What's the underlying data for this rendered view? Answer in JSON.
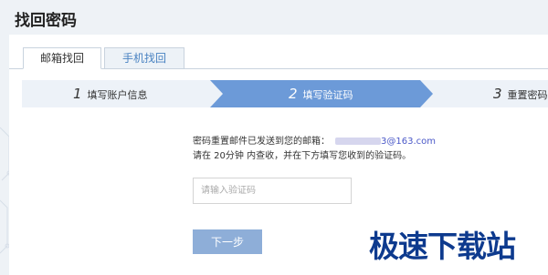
{
  "page": {
    "title": "找回密码"
  },
  "tabs": [
    {
      "label": "邮箱找回",
      "active": true
    },
    {
      "label": "手机找回",
      "active": false
    }
  ],
  "steps": [
    {
      "number": "1",
      "label": "填写账户信息",
      "state": "done"
    },
    {
      "number": "2",
      "label": "填写验证码",
      "state": "current"
    },
    {
      "number": "3",
      "label": "重置密码",
      "state": "pending"
    }
  ],
  "message": {
    "line1_prefix": "密码重置邮件已发送到您的邮箱：",
    "email_visible": "3@163.com",
    "line2": "请在 20分钟 内查收，并在下方填写您收到的验证码。"
  },
  "code_input": {
    "placeholder": "请输入验证码",
    "value": ""
  },
  "next_button": {
    "label": "下一步"
  },
  "watermark": {
    "text": "极速下载站"
  },
  "colors": {
    "accent": "#6c9ad8",
    "step_bg": "#edf2f8",
    "button": "#8eaed8",
    "watermark": "#0d3a8e"
  }
}
